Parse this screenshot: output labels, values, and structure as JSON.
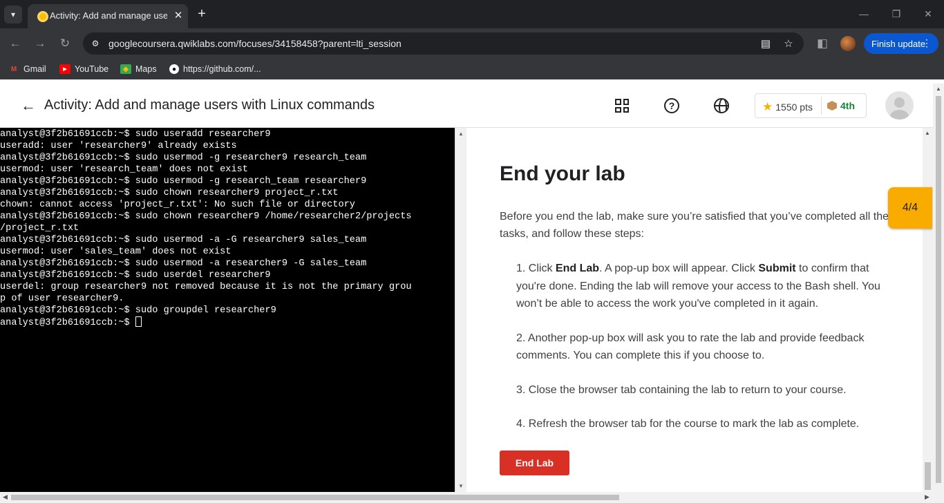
{
  "browser": {
    "tab_title": "Activity: Add and manage users",
    "url": "googlecoursera.qwiklabs.com/focuses/34158458?parent=lti_session",
    "finish_update_label": "Finish update",
    "bookmarks": [
      {
        "label": "Gmail",
        "icon": "gmail-icon",
        "color": "#ea4335"
      },
      {
        "label": "YouTube",
        "icon": "youtube-icon",
        "color": "#ff0000"
      },
      {
        "label": "Maps",
        "icon": "maps-icon",
        "color": "#34a853"
      },
      {
        "label": "https://github.com/...",
        "icon": "github-icon",
        "color": "#ffffff"
      }
    ]
  },
  "header": {
    "title": "Activity: Add and manage users with Linux commands",
    "points": "1550 pts",
    "rank": "4th"
  },
  "terminal": {
    "lines": [
      "analyst@3f2b61691ccb:~$ sudo useradd researcher9",
      "useradd: user 'researcher9' already exists",
      "analyst@3f2b61691ccb:~$ sudo usermod -g researcher9 research_team",
      "usermod: user 'research_team' does not exist",
      "analyst@3f2b61691ccb:~$ sudo usermod -g research_team researcher9",
      "analyst@3f2b61691ccb:~$ sudo chown researcher9 project_r.txt",
      "chown: cannot access 'project_r.txt': No such file or directory",
      "analyst@3f2b61691ccb:~$ sudo chown researcher9 /home/researcher2/projects",
      "/project_r.txt",
      "analyst@3f2b61691ccb:~$ sudo usermod -a -G researcher9 sales_team",
      "usermod: user 'sales_team' does not exist",
      "analyst@3f2b61691ccb:~$ sudo usermod -a researcher9 -G sales_team",
      "analyst@3f2b61691ccb:~$ sudo userdel researcher9",
      "userdel: group researcher9 not removed because it is not the primary grou",
      "p of user researcher9.",
      "analyst@3f2b61691ccb:~$ sudo groupdel researcher9",
      "analyst@3f2b61691ccb:~$ "
    ]
  },
  "instructions": {
    "title": "End your lab",
    "intro": "Before you end the lab, make sure you’re satisfied that you’ve completed all the tasks, and follow these steps:",
    "steps": [
      {
        "num": "1.",
        "parts": [
          {
            "t": "Click ",
            "b": false
          },
          {
            "t": "End Lab",
            "b": true
          },
          {
            "t": ". A pop-up box will appear. Click ",
            "b": false
          },
          {
            "t": "Submit",
            "b": true
          },
          {
            "t": " to confirm that you're done. Ending the lab will remove your access to the Bash shell. You won’t be able to access the work you've completed in it again.",
            "b": false
          }
        ]
      },
      {
        "num": "2.",
        "parts": [
          {
            "t": "Another pop-up box will ask you to rate the lab and provide feedback comments. You can complete this if you choose to.",
            "b": false
          }
        ]
      },
      {
        "num": "3.",
        "parts": [
          {
            "t": "Close the browser tab containing the lab to return to your course.",
            "b": false
          }
        ]
      },
      {
        "num": "4.",
        "parts": [
          {
            "t": "Refresh the browser tab for the course to mark the lab as complete.",
            "b": false
          }
        ]
      }
    ],
    "end_lab_button": "End Lab",
    "step_counter": "4/4"
  }
}
